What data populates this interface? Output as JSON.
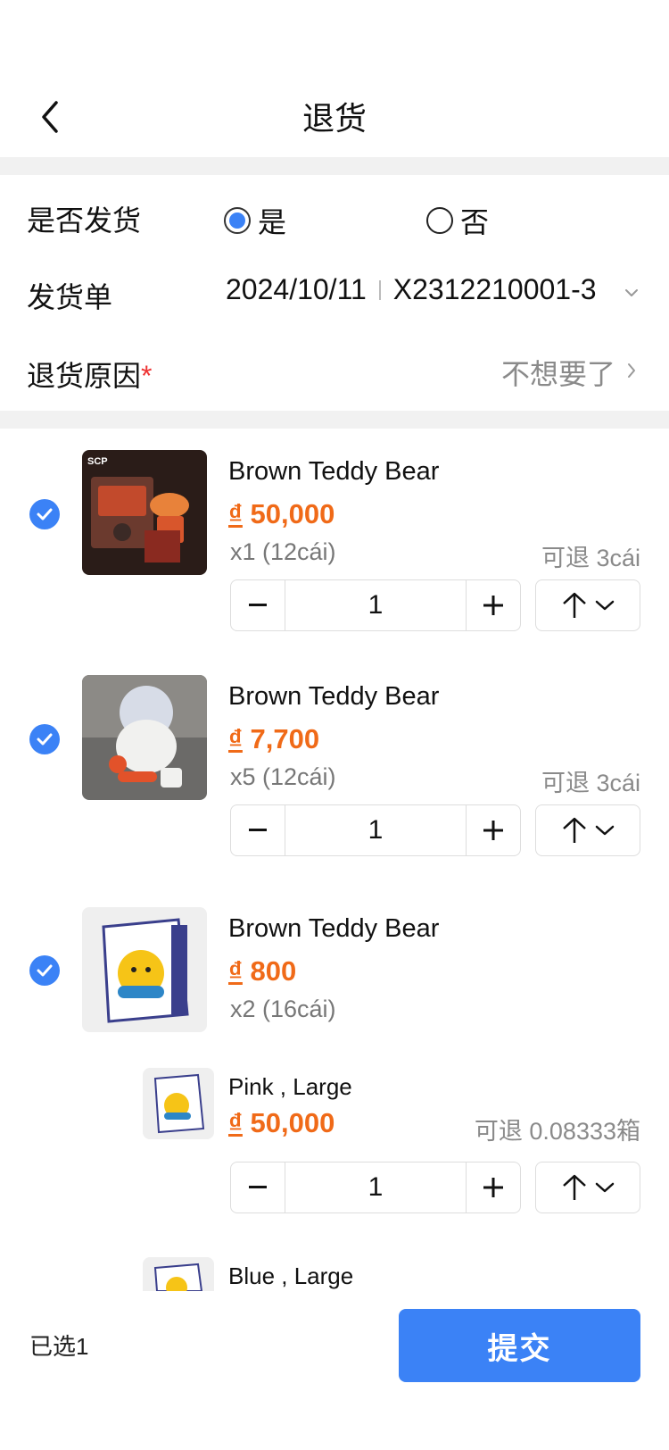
{
  "header": {
    "title": "退货"
  },
  "form": {
    "shipped_label": "是否发货",
    "shipped_yes": "是",
    "shipped_no": "否",
    "shipped_selected": "是",
    "invoice_label": "发货单",
    "invoice_date": "2024/10/11",
    "invoice_no": "X2312210001-3",
    "reason_label": "退货原因",
    "reason_required": "*",
    "reason_value": "不想要了"
  },
  "items": [
    {
      "name": "Brown Teddy Bear",
      "currency": "₫",
      "price": "50,000",
      "qty_info": "x1 (12cái)",
      "returnable": "可退 3cái",
      "qty": "1",
      "checked": true
    },
    {
      "name": "Brown Teddy Bear",
      "currency": "₫",
      "price": "7,700",
      "qty_info": "x5 (12cái)",
      "returnable": "可退 3cái",
      "qty": "1",
      "checked": true
    },
    {
      "name": "Brown Teddy Bear",
      "currency": "₫",
      "price": "800",
      "qty_info": "x2 (16cái)",
      "checked": true,
      "variants": [
        {
          "name": "Pink , Large",
          "currency": "₫",
          "price": "50,000",
          "returnable": "可退 0.08333箱",
          "qty": "1"
        },
        {
          "name": "Blue , Large"
        }
      ]
    }
  ],
  "footer": {
    "selected": "已选1",
    "submit": "提交"
  },
  "colors": {
    "accent": "#3b82f6",
    "price": "#f06a18",
    "divider": "#f1f1f1"
  }
}
